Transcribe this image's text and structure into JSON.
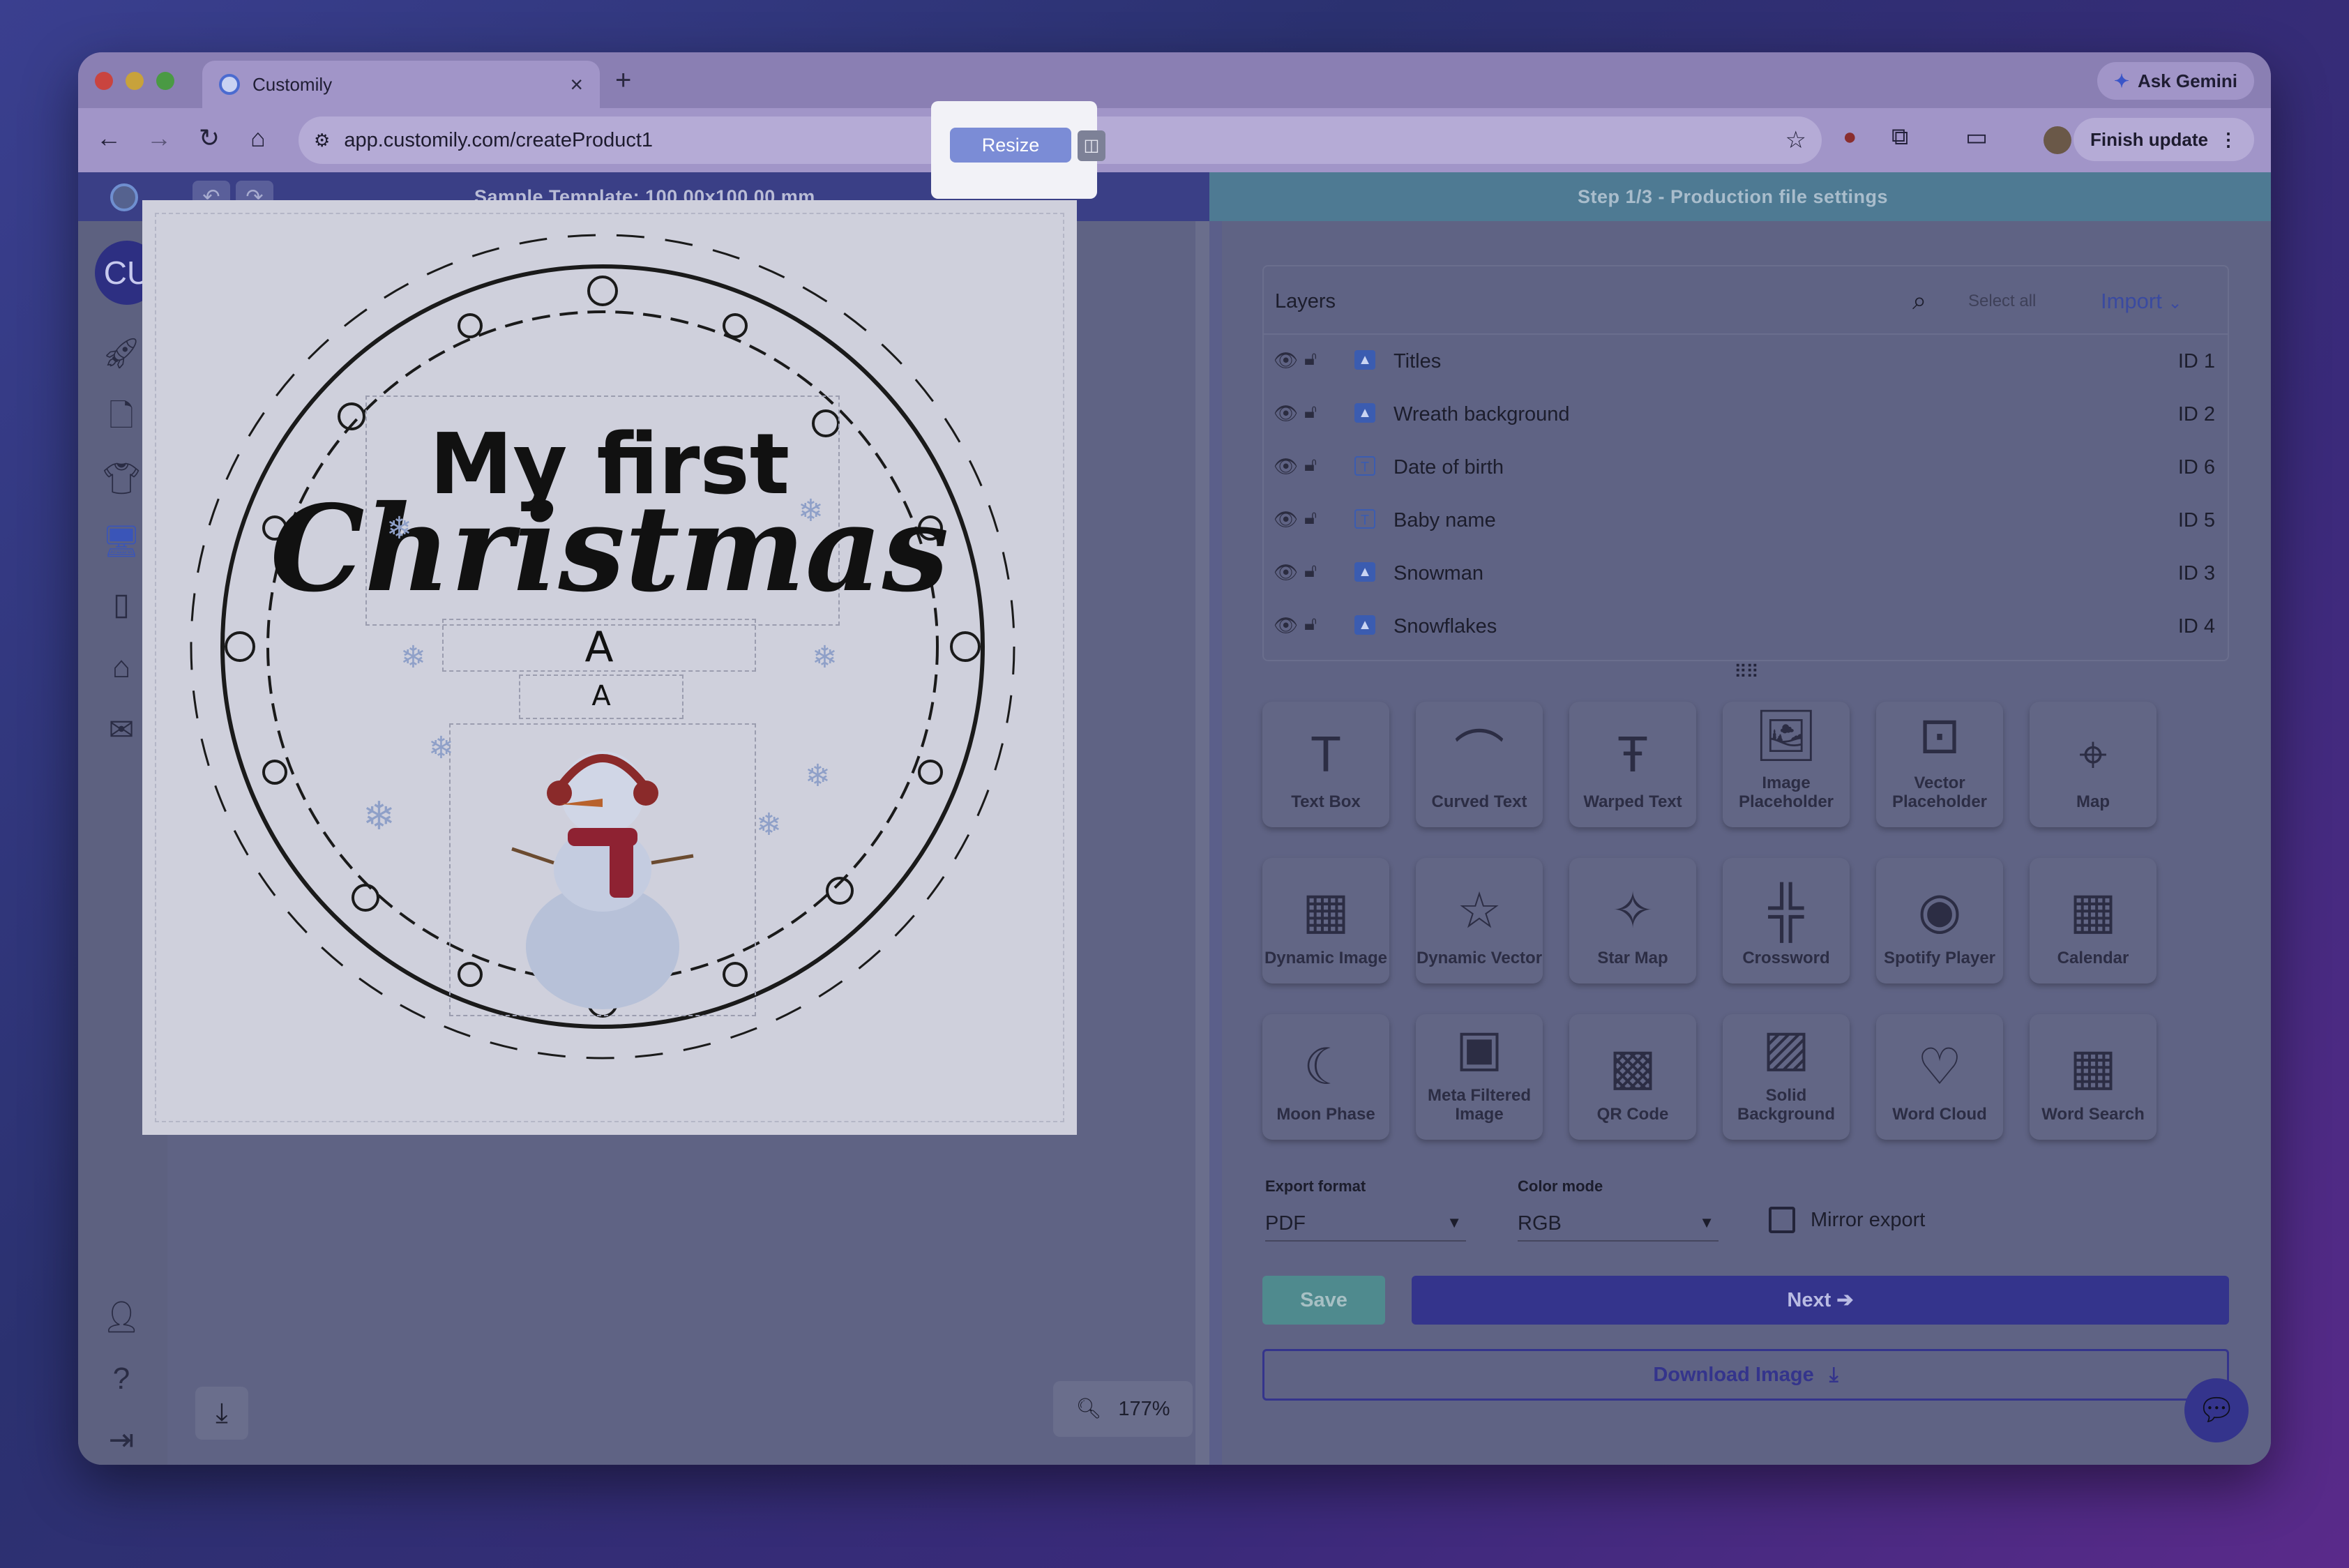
{
  "browser": {
    "tab_title": "Customily",
    "tab_close": "×",
    "new_tab": "+",
    "gemini_label": "Ask Gemini",
    "url": "app.customily.com/createProduct1",
    "finish_update_label": "Finish update"
  },
  "app_header": {
    "template_title": "Sample Template: 100.00x100.00 mm",
    "resize_label": "Resize",
    "step_title": "Step 1/3 - Production file settings"
  },
  "sidebar": {
    "avatar_initials": "CU"
  },
  "canvas": {
    "title_line1": "My first",
    "title_line2": "Christmas",
    "placeholder1": "A",
    "placeholder2": "A",
    "zoom": "177%"
  },
  "layers": {
    "title": "Layers",
    "select_all": "Select all",
    "import_label": "Import",
    "items": [
      {
        "name": "Titles",
        "id": "ID 1",
        "type": "image"
      },
      {
        "name": "Wreath background",
        "id": "ID 2",
        "type": "image"
      },
      {
        "name": "Date of birth",
        "id": "ID 6",
        "type": "text"
      },
      {
        "name": "Baby name",
        "id": "ID 5",
        "type": "text"
      },
      {
        "name": "Snowman",
        "id": "ID 3",
        "type": "image"
      },
      {
        "name": "Snowflakes",
        "id": "ID 4",
        "type": "image"
      }
    ]
  },
  "tools": [
    {
      "label": "Text Box",
      "icon": "text-box-icon"
    },
    {
      "label": "Curved Text",
      "icon": "curved-text-icon"
    },
    {
      "label": "Warped Text",
      "icon": "warped-text-icon"
    },
    {
      "label": "Image Placeholder",
      "icon": "image-placeholder-icon"
    },
    {
      "label": "Vector Placeholder",
      "icon": "vector-placeholder-icon"
    },
    {
      "label": "Map",
      "icon": "map-icon"
    },
    {
      "label": "Dynamic Image",
      "icon": "dynamic-image-icon"
    },
    {
      "label": "Dynamic Vector",
      "icon": "dynamic-vector-icon"
    },
    {
      "label": "Star Map",
      "icon": "star-map-icon"
    },
    {
      "label": "Crossword",
      "icon": "crossword-icon"
    },
    {
      "label": "Spotify Player",
      "icon": "spotify-icon"
    },
    {
      "label": "Calendar",
      "icon": "calendar-icon"
    },
    {
      "label": "Moon Phase",
      "icon": "moon-phase-icon"
    },
    {
      "label": "Meta Filtered Image",
      "icon": "meta-filtered-image-icon"
    },
    {
      "label": "QR Code",
      "icon": "qr-code-icon"
    },
    {
      "label": "Solid Background",
      "icon": "solid-background-icon"
    },
    {
      "label": "Word Cloud",
      "icon": "word-cloud-icon"
    },
    {
      "label": "Word Search",
      "icon": "word-search-icon"
    }
  ],
  "export": {
    "format_label": "Export format",
    "format_value": "PDF",
    "color_label": "Color mode",
    "color_value": "RGB",
    "mirror_label": "Mirror export",
    "mirror_checked": false
  },
  "actions": {
    "save_label": "Save",
    "next_label": "Next ➔",
    "download_label": "Download Image"
  }
}
